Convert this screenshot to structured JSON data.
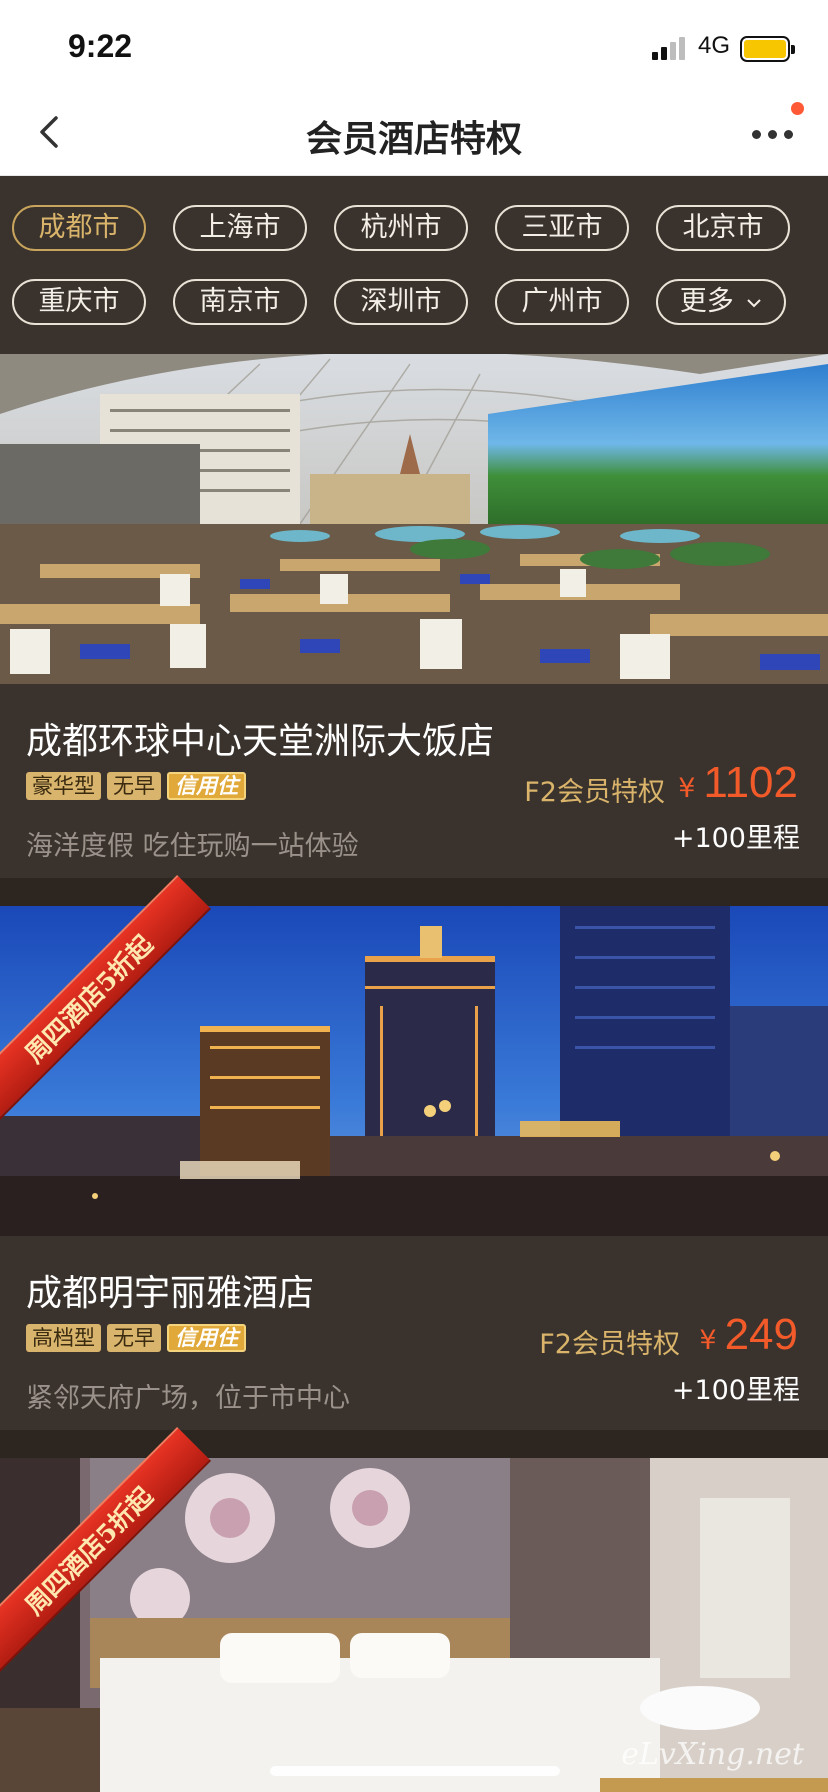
{
  "status_bar": {
    "time": "9:22",
    "network": "4G"
  },
  "nav": {
    "title": "会员酒店特权"
  },
  "cities": [
    "成都市",
    "上海市",
    "杭州市",
    "三亚市",
    "北京市",
    "重庆市",
    "南京市",
    "深圳市",
    "广州市",
    "更多"
  ],
  "hotels": [
    {
      "name": "成都环球中心天堂洲际大饭店",
      "tags": [
        "豪华型",
        "无早",
        "信用住"
      ],
      "desc": "海洋度假 吃住玩购一站体验",
      "privilege": "F2会员特权",
      "currency": "¥",
      "price": "1102",
      "mileage": "+100里程"
    },
    {
      "name": "成都明宇丽雅酒店",
      "tags": [
        "高档型",
        "无早",
        "信用住"
      ],
      "desc": "紧邻天府广场，位于市中心",
      "privilege": "F2会员特权",
      "currency": "¥",
      "price": "249",
      "mileage": "+100里程",
      "ribbon": "周四酒店5折起"
    },
    {
      "ribbon": "周四酒店5折起"
    }
  ],
  "watermark": "eLvXing.net",
  "colors": {
    "accent_gold": "#d9b46a",
    "price_orange": "#f25a2a",
    "card_bg": "#3a332d",
    "ribbon_red": "#d42a1c"
  }
}
